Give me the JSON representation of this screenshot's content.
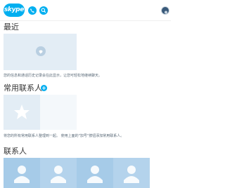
{
  "header": {
    "logo_text": "skype",
    "buttons": [
      {
        "name": "call-icon"
      },
      {
        "name": "search-icon"
      }
    ],
    "avatar_icon": "profile-avatar"
  },
  "recent": {
    "title": "最近",
    "hint": "您的信息和通话历史记录会在此显示，让您可轻松地继续聊天。",
    "icon": "chat-bubble-icon"
  },
  "favorites": {
    "title": "常用联系人",
    "add_label": "+",
    "hint": "将您的所有常用联系人整理到一起。 使用上面的\"加号\"按钮添加常用联系人。",
    "icon": "star-icon"
  },
  "contacts": {
    "title": "联系人",
    "tiles": [
      {
        "icon": "person-icon"
      },
      {
        "icon": "person-icon"
      },
      {
        "icon": "person-icon"
      },
      {
        "icon": "person-icon"
      }
    ]
  },
  "colors": {
    "brand": "#00aff0",
    "tile_light": "#e3edf5",
    "contact_tile": "#a6cbe8"
  }
}
